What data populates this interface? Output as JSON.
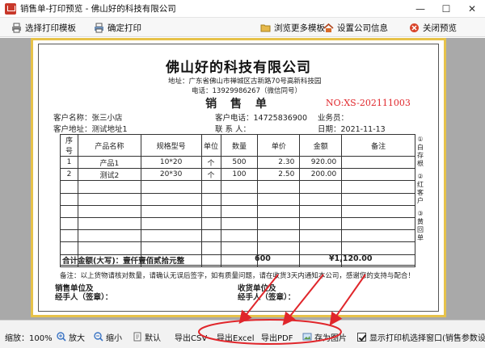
{
  "window": {
    "title": "销售单-打印预览 - 佛山好的科技有限公司",
    "minimize": "—",
    "maximize": "☐",
    "close": "✕"
  },
  "toolbar": {
    "select_template": "选择打印模板",
    "confirm_print": "确定打印",
    "browse_templates": "浏览更多模板",
    "company_info": "设置公司信息",
    "close_preview": "关闭预览"
  },
  "document": {
    "company": "佛山好的科技有限公司",
    "address": "地址：广东省佛山市禅城区古新路70号高新科技园",
    "phone": "电话：13929986267（微信同号）",
    "title": "销 售 单",
    "doc_no": "NO:XS-202111003",
    "customer_name_label": "客户名称：张三小店",
    "customer_phone_label": "客户电话：14725836900",
    "salesperson_label": "业务员：",
    "customer_addr_label": "客户地址：测试地址1",
    "contact_label": "联 系 人：",
    "date_label": "日期：2021-11-13",
    "columns": [
      "序号",
      "产品名称",
      "规格型号",
      "单位",
      "数量",
      "单价",
      "金额",
      "备注"
    ],
    "rows": [
      {
        "no": "1",
        "name": "产品1",
        "spec": "10*20",
        "unit": "个",
        "qty": "500",
        "price": "2.30",
        "amount": "920.00",
        "remark": ""
      },
      {
        "no": "2",
        "name": "测试2",
        "spec": "20*30",
        "unit": "个",
        "qty": "100",
        "price": "2.50",
        "amount": "200.00",
        "remark": ""
      }
    ],
    "side_notes": [
      "①白存根",
      "②红客户",
      "③黄回单"
    ],
    "total_label": "合计金额(大写)：壹仟壹佰贰拾元整",
    "total_qty": "600",
    "total_amount": "¥1,120.00",
    "remark_note": "备注：以上货物请核对数量，请确认无误后签字，如有质量问题，请在收货3天内通知本公司，感谢您的支持与配合！",
    "seller_sign_1": "销售单位及",
    "seller_sign_2": "经手人（签章）：",
    "buyer_sign_1": "收货单位及",
    "buyer_sign_2": "经手人（签章）："
  },
  "statusbar": {
    "zoom_label": "缩放：100%",
    "zoom_in": "放大",
    "zoom_out": "缩小",
    "default": "默认",
    "export_csv": "导出CSV",
    "export_excel": "导出Excel",
    "export_pdf": "导出PDF",
    "save_image": "存为图片",
    "show_printer_dialog": "显示打印机选择窗口(销售参数设置)"
  },
  "colors": {
    "accent_red": "#e0262b",
    "page_border": "#e6c24a",
    "annotation_red": "#e0262b"
  }
}
